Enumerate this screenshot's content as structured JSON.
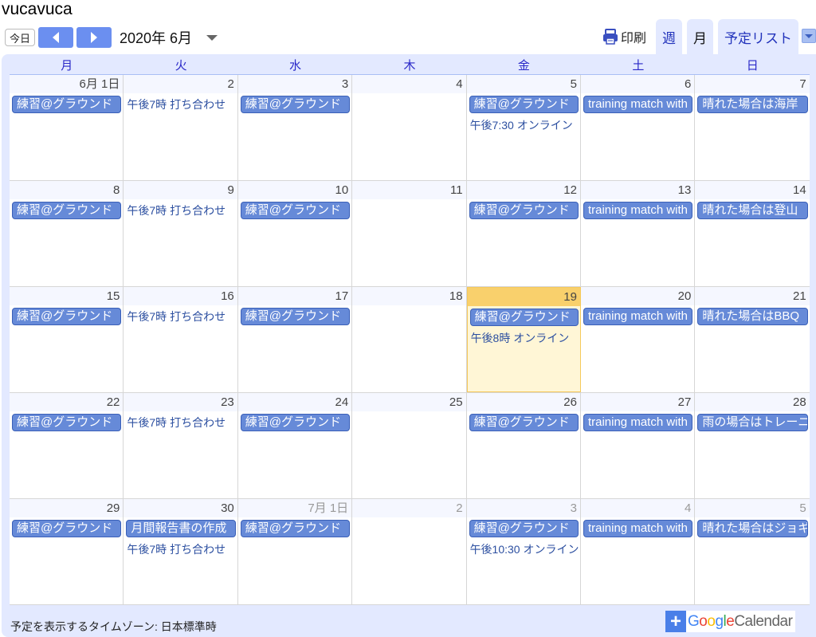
{
  "app_title": "vucavuca",
  "nav": {
    "today_label": "今日",
    "prev_icon": "arrow-left-icon",
    "next_icon": "arrow-right-icon",
    "month_label": "2020年 6月"
  },
  "right_nav": {
    "print_label": "印刷",
    "tabs": [
      {
        "label": "週",
        "active": false
      },
      {
        "label": "月",
        "active": true
      },
      {
        "label": "予定リスト",
        "active": false
      }
    ]
  },
  "weekdays": [
    "月",
    "火",
    "水",
    "木",
    "金",
    "土",
    "日"
  ],
  "colors": {
    "event_bg": "#668ad8",
    "event_border": "#3a60b8",
    "today_head": "#f9d06c",
    "today_bg": "#fff6d6",
    "weekday_text": "#2a28c8",
    "frame_bg": "#e3e9ff"
  },
  "weeks": [
    {
      "days": [
        {
          "label": "6月 1日",
          "events": [
            {
              "type": "block",
              "title": "練習@グラウンド"
            }
          ]
        },
        {
          "label": "2",
          "events": [
            {
              "type": "text",
              "title": "午後7時 打ち合わせ"
            }
          ]
        },
        {
          "label": "3",
          "events": [
            {
              "type": "block",
              "title": "練習@グラウンド"
            }
          ]
        },
        {
          "label": "4",
          "events": []
        },
        {
          "label": "5",
          "events": [
            {
              "type": "block",
              "title": "練習@グラウンド"
            },
            {
              "type": "text",
              "title": "午後7:30 オンライン"
            }
          ]
        },
        {
          "label": "6",
          "events": [
            {
              "type": "block",
              "title": "training match with"
            }
          ]
        },
        {
          "label": "7",
          "events": [
            {
              "type": "block",
              "title": "晴れた場合は海岸"
            }
          ]
        }
      ]
    },
    {
      "days": [
        {
          "label": "8",
          "events": [
            {
              "type": "block",
              "title": "練習@グラウンド"
            }
          ]
        },
        {
          "label": "9",
          "events": [
            {
              "type": "text",
              "title": "午後7時 打ち合わせ"
            }
          ]
        },
        {
          "label": "10",
          "events": [
            {
              "type": "block",
              "title": "練習@グラウンド"
            }
          ]
        },
        {
          "label": "11",
          "events": []
        },
        {
          "label": "12",
          "events": [
            {
              "type": "block",
              "title": "練習@グラウンド"
            }
          ]
        },
        {
          "label": "13",
          "events": [
            {
              "type": "block",
              "title": "training match with"
            }
          ]
        },
        {
          "label": "14",
          "events": [
            {
              "type": "block",
              "title": "晴れた場合は登山"
            }
          ]
        }
      ]
    },
    {
      "days": [
        {
          "label": "15",
          "events": [
            {
              "type": "block",
              "title": "練習@グラウンド"
            }
          ]
        },
        {
          "label": "16",
          "events": [
            {
              "type": "text",
              "title": "午後7時 打ち合わせ"
            }
          ]
        },
        {
          "label": "17",
          "events": [
            {
              "type": "block",
              "title": "練習@グラウンド"
            }
          ]
        },
        {
          "label": "18",
          "events": []
        },
        {
          "label": "19",
          "today": true,
          "events": [
            {
              "type": "block",
              "title": "練習@グラウンド"
            },
            {
              "type": "text",
              "title": "午後8時 オンライン"
            }
          ]
        },
        {
          "label": "20",
          "events": [
            {
              "type": "block",
              "title": "training match with"
            }
          ]
        },
        {
          "label": "21",
          "events": [
            {
              "type": "block",
              "title": "晴れた場合はBBQ"
            }
          ]
        }
      ]
    },
    {
      "days": [
        {
          "label": "22",
          "events": [
            {
              "type": "block",
              "title": "練習@グラウンド"
            }
          ]
        },
        {
          "label": "23",
          "events": [
            {
              "type": "text",
              "title": "午後7時 打ち合わせ"
            }
          ]
        },
        {
          "label": "24",
          "events": [
            {
              "type": "block",
              "title": "練習@グラウンド"
            }
          ]
        },
        {
          "label": "25",
          "events": []
        },
        {
          "label": "26",
          "events": [
            {
              "type": "block",
              "title": "練習@グラウンド"
            }
          ]
        },
        {
          "label": "27",
          "events": [
            {
              "type": "block",
              "title": "training match with"
            }
          ]
        },
        {
          "label": "28",
          "events": [
            {
              "type": "block",
              "title": "雨の場合はトレーニング"
            }
          ]
        }
      ]
    },
    {
      "days": [
        {
          "label": "29",
          "events": [
            {
              "type": "block",
              "title": "練習@グラウンド"
            }
          ]
        },
        {
          "label": "30",
          "events": [
            {
              "type": "block",
              "title": "月間報告書の作成"
            },
            {
              "type": "text",
              "title": "午後7時 打ち合わせ"
            }
          ]
        },
        {
          "label": "7月 1日",
          "other": true,
          "events": [
            {
              "type": "block",
              "title": "練習@グラウンド"
            }
          ]
        },
        {
          "label": "2",
          "other": true,
          "events": []
        },
        {
          "label": "3",
          "other": true,
          "events": [
            {
              "type": "block",
              "title": "練習@グラウンド"
            },
            {
              "type": "text",
              "title": "午後10:30 オンライン"
            }
          ]
        },
        {
          "label": "4",
          "other": true,
          "events": [
            {
              "type": "block",
              "title": "training match with"
            }
          ]
        },
        {
          "label": "5",
          "other": true,
          "events": [
            {
              "type": "block",
              "title": "晴れた場合はジョギング"
            }
          ]
        }
      ]
    }
  ],
  "footer": {
    "timezone_label": "予定を表示するタイムゾーン: 日本標準時",
    "google_calendar_button": {
      "plus": "+",
      "brand": "Google",
      "product": "Calendar"
    }
  }
}
